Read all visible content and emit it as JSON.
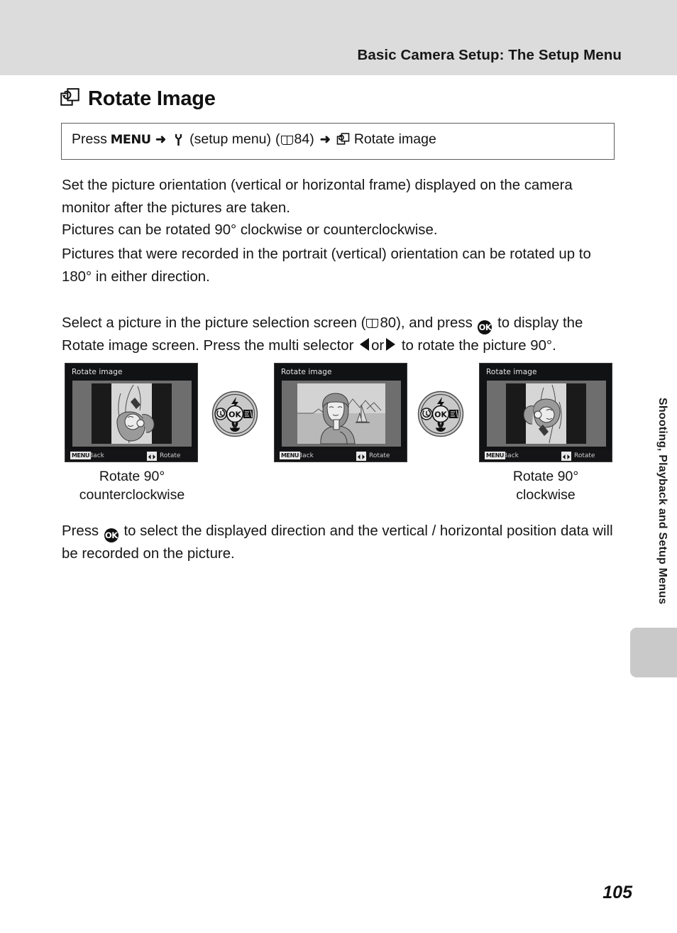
{
  "header": {
    "title": "Basic Camera Setup: The Setup Menu"
  },
  "heading": {
    "icon": "rotate-image-icon",
    "text": "Rotate Image"
  },
  "press_box": {
    "press_label": "Press",
    "menu_button": "MENU",
    "arrow1": "➜",
    "setup_icon": "wrench-icon",
    "setup_menu_label": "(setup menu)",
    "ref_open": "(",
    "ref_icon": "book-icon",
    "ref_page": "84",
    "ref_close": ")",
    "arrow2": "➜",
    "item_icon": "rotate-image-icon",
    "item_label": "Rotate image"
  },
  "body": {
    "para1": "Set the picture orientation (vertical or horizontal frame) displayed on the camera monitor after the pictures are taken.",
    "para2": "Pictures can be rotated 90° clockwise or counterclockwise.",
    "para3": "Pictures that were recorded in the portrait (vertical) orientation can be rotated up to 180° in either direction.",
    "para4_a": "Select a picture in the picture selection screen (",
    "para4_page": "80",
    "para4_b": "), and press",
    "para4_c": "to display the Rotate image screen. Press the multi selector",
    "para4_or": "or",
    "para4_d": "to rotate the picture 90°.",
    "para5_a": "Press",
    "para5_b": "to select the displayed direction and the vertical / horizontal position data will be recorded on the picture."
  },
  "screens": [
    {
      "id": "screen-left",
      "title": "Rotate image",
      "menu_chip": "MENU",
      "back_label": "Back",
      "rotate_label": "Rotate",
      "orientation": "portrait",
      "photo": "woman-portrait-rotated-ccw"
    },
    {
      "id": "screen-center",
      "title": "Rotate image",
      "menu_chip": "MENU",
      "back_label": "Back",
      "rotate_label": "Rotate",
      "orientation": "landscape",
      "photo": "woman-with-sailboat-landscape"
    },
    {
      "id": "screen-right",
      "title": "Rotate image",
      "menu_chip": "MENU",
      "back_label": "Back",
      "rotate_label": "Rotate",
      "orientation": "portrait",
      "photo": "woman-portrait-rotated-cw"
    }
  ],
  "dials": [
    {
      "id": "dial-left",
      "top_icon": "flash-icon",
      "left_icon": "self-timer-icon",
      "center_icon": "ok-button-icon",
      "right_icon": "exposure-compensation-icon",
      "bottom_icon": "macro-flower-icon"
    },
    {
      "id": "dial-right",
      "top_icon": "flash-icon",
      "left_icon": "self-timer-icon",
      "center_icon": "ok-button-icon",
      "right_icon": "exposure-compensation-icon",
      "bottom_icon": "macro-flower-icon"
    }
  ],
  "captions": {
    "left_line1": "Rotate 90°",
    "left_line2": "counterclockwise",
    "right_line1": "Rotate 90°",
    "right_line2": "clockwise"
  },
  "side_tab": {
    "label": "Shooting, Playback and Setup Menus",
    "color": "#c9c9c9"
  },
  "footer": {
    "page_number": "105"
  },
  "colors": {
    "header_band": "#dcdcdc",
    "text": "#161616",
    "screen_bg": "#111214",
    "screen_body": "#6e6e6e",
    "dial_fill": "#c9c9c9"
  }
}
